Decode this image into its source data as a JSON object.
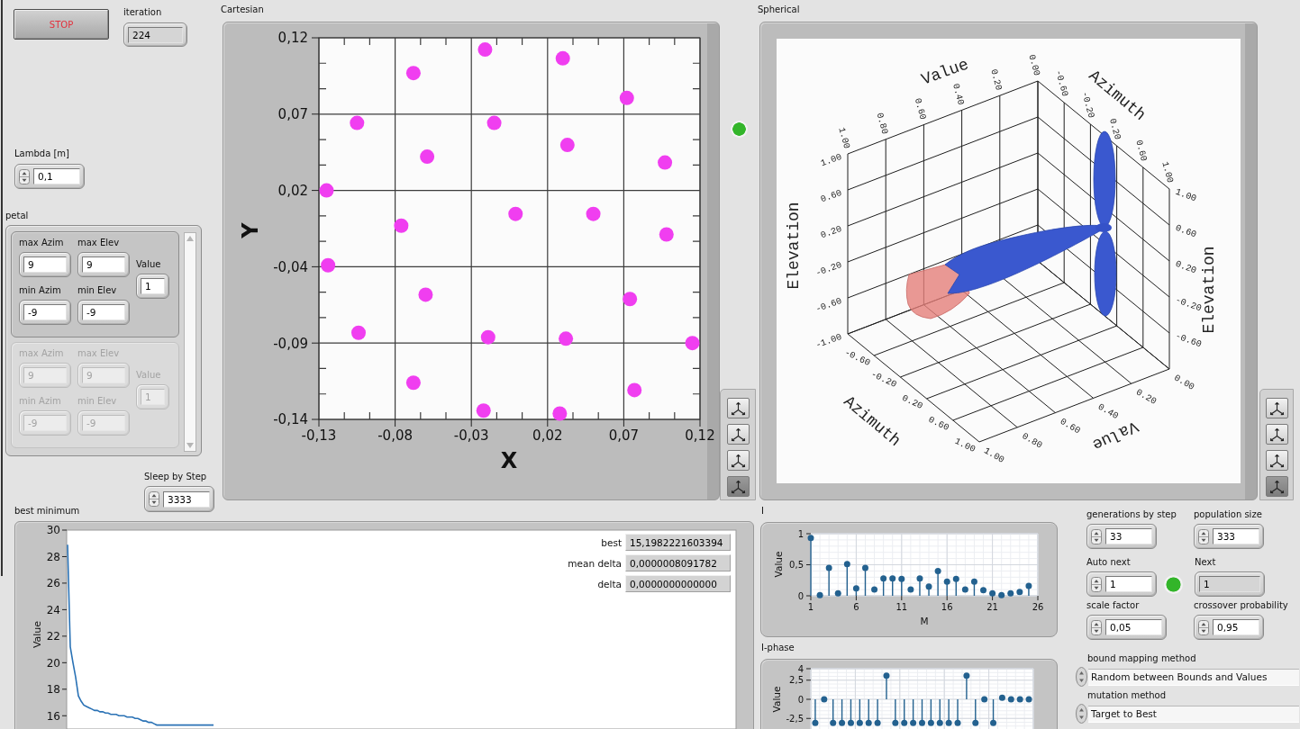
{
  "stop_button": {
    "label": "STOP"
  },
  "iteration": {
    "label": "iteration",
    "kind": "indicator",
    "value": "224"
  },
  "lambda": {
    "label": "Lambda [m]",
    "kind": "spin",
    "value": "0,1"
  },
  "petal": {
    "label": "petal",
    "elements": [
      {
        "disabled": false,
        "fields": [
          {
            "label": "max Azim",
            "value": "9"
          },
          {
            "label": "max Elev",
            "value": "9"
          },
          {
            "label": "Value",
            "value": "1"
          },
          {
            "label": "min Azim",
            "value": "-9"
          },
          {
            "label": "min Elev",
            "value": "-9"
          }
        ]
      },
      {
        "disabled": true,
        "fields": [
          {
            "label": "max Azim",
            "value": "9"
          },
          {
            "label": "max Elev",
            "value": "9"
          },
          {
            "label": "Value",
            "value": "1"
          },
          {
            "label": "min Azim",
            "value": "-9"
          },
          {
            "label": "min Elev",
            "value": "-9"
          }
        ]
      }
    ]
  },
  "sleep_by_step": {
    "label": "Sleep by Step",
    "kind": "spin",
    "value": "3333"
  },
  "cartesian": {
    "label": "Cartesian",
    "chart_data": [
      {
        "type": "scatter",
        "xlabel": "X",
        "ylabel": "Y",
        "xlim": [
          -0.13,
          0.12
        ],
        "ylim": [
          -0.14,
          0.12
        ],
        "xticks": [
          {
            "value": -0.13,
            "label": "-0,13"
          },
          {
            "value": -0.08,
            "label": "-0,08"
          },
          {
            "value": -0.03,
            "label": "-0,03"
          },
          {
            "value": 0.02,
            "label": "0,02"
          },
          {
            "value": 0.07,
            "label": "0,07"
          },
          {
            "value": 0.12,
            "label": "0,12"
          }
        ],
        "yticks": [
          {
            "value": 0.12,
            "label": "0,12"
          },
          {
            "value": 0.068,
            "label": "0,07"
          },
          {
            "value": 0.016,
            "label": "0,02"
          },
          {
            "value": -0.036,
            "label": "-0,04"
          },
          {
            "value": -0.088,
            "label": "-0,09"
          },
          {
            "value": -0.14,
            "label": "-0,14"
          }
        ],
        "grid": true,
        "color": "#f03ef0",
        "x": [
          -0.021,
          0.03,
          -0.068,
          0.072,
          -0.105,
          -0.015,
          0.033,
          -0.059,
          0.097,
          -0.125,
          -0.001,
          0.05,
          -0.076,
          0.098,
          -0.124,
          -0.06,
          0.074,
          -0.104,
          -0.019,
          0.032,
          0.115,
          -0.068,
          0.077,
          -0.022,
          0.028
        ],
        "values": [
          0.112,
          0.106,
          0.096,
          0.079,
          0.062,
          0.062,
          0.047,
          0.039,
          0.035,
          0.016,
          0,
          0,
          -0.008,
          -0.014,
          -0.035,
          -0.055,
          -0.058,
          -0.081,
          -0.084,
          -0.085,
          -0.088,
          -0.115,
          -0.12,
          -0.134,
          -0.136
        ]
      }
    ],
    "palette": [
      {
        "selected": false
      },
      {
        "selected": false
      },
      {
        "selected": false
      },
      {
        "selected": true
      }
    ]
  },
  "status_led": {
    "on": true
  },
  "spherical": {
    "label": "Spherical",
    "axes": [
      {
        "kind": "topleft",
        "title": "Value",
        "ticks": [
          "1.00",
          "0.80",
          "0.60",
          "0.40",
          "0.20",
          "0.00"
        ]
      },
      {
        "kind": "topright",
        "title": "Azimuth",
        "ticks": [
          "-0.60",
          "-0.20",
          "0.20",
          "0.60",
          "1.00"
        ]
      },
      {
        "kind": "left",
        "title": "Elevation",
        "ticks": [
          "1.00",
          "0.60",
          "0.20",
          "-0.20",
          "-0.60",
          "-1.00"
        ]
      },
      {
        "kind": "right",
        "title": "Elevation",
        "ticks": [
          "1.00",
          "0.60",
          "0.20",
          "-0.20",
          "-0.60"
        ]
      },
      {
        "kind": "bottomleft",
        "title": "Azimuth",
        "ticks": [
          "-0.60",
          "-0.20",
          "0.20",
          "0.60",
          "1.00"
        ]
      },
      {
        "kind": "bottomright",
        "title": "Value",
        "ticks": [
          "0.00",
          "0.20",
          "0.40",
          "0.60",
          "0.80",
          "1.00"
        ]
      }
    ],
    "palette": [
      {
        "selected": false
      },
      {
        "selected": false
      },
      {
        "selected": false
      },
      {
        "selected": true
      }
    ]
  },
  "best_minimum": {
    "label": "best minimum",
    "readouts": [
      {
        "label": "best",
        "value": "15,1982221603394"
      },
      {
        "label": "mean delta",
        "value": "0,0000008091782"
      },
      {
        "label": "delta",
        "value": "0,0000000000000"
      }
    ],
    "chart_data": [
      {
        "type": "line",
        "ylabel": "Value",
        "ylim": [
          15,
          30
        ],
        "yticks": [
          {
            "value": 16,
            "label": "16"
          },
          {
            "value": 18,
            "label": "18"
          },
          {
            "value": 20,
            "label": "20"
          },
          {
            "value": 22,
            "label": "22"
          },
          {
            "value": 24,
            "label": "24"
          },
          {
            "value": 26,
            "label": "26"
          },
          {
            "value": 28,
            "label": "28"
          },
          {
            "value": 30,
            "label": "30"
          }
        ],
        "tick_labels": "y",
        "color": "#2a72b5",
        "values": [
          28.9,
          21.2,
          20.0,
          18.9,
          17.5,
          17.1,
          16.8,
          16.7,
          16.6,
          16.5,
          16.4,
          16.4,
          16.3,
          16.3,
          16.2,
          16.2,
          16.1,
          16.1,
          16.1,
          16.0,
          16.0,
          16.0,
          15.9,
          15.9,
          15.9,
          15.8,
          15.8,
          15.7,
          15.6,
          15.6,
          15.5,
          15.5,
          15.4,
          15.3,
          15.3,
          15.3,
          15.3,
          15.3,
          15.3,
          15.3,
          15.3,
          15.3,
          15.3,
          15.3,
          15.3,
          15.3,
          15.3,
          15.3,
          15.3,
          15.3,
          15.3,
          15.3,
          15.3,
          15.3,
          15.3
        ]
      }
    ]
  },
  "i_chart": {
    "label": "I",
    "chart_data": [
      {
        "type": "lollipop",
        "xlabel": "M",
        "ylabel": "Value",
        "x": [
          1,
          2,
          3,
          4,
          5,
          6,
          7,
          8,
          9,
          10,
          11,
          12,
          13,
          14,
          15,
          16,
          17,
          18,
          19,
          20,
          21,
          22,
          23,
          24,
          25
        ],
        "xlim": [
          1,
          26
        ],
        "ylim": [
          0,
          1
        ],
        "xticks": [
          {
            "value": 1,
            "label": "1"
          },
          {
            "value": 6,
            "label": "6"
          },
          {
            "value": 11,
            "label": "11"
          },
          {
            "value": 16,
            "label": "16"
          },
          {
            "value": 21,
            "label": "21"
          },
          {
            "value": 26,
            "label": "26"
          }
        ],
        "yticks": [
          {
            "value": 1,
            "label": "1"
          },
          {
            "value": 0.5,
            "label": "0,5"
          },
          {
            "value": 0,
            "label": "0"
          }
        ],
        "grid": true,
        "color": "#23618f",
        "values": [
          0.93,
          0.01,
          0.45,
          0.04,
          0.51,
          0.12,
          0.45,
          0.1,
          0.28,
          0.28,
          0.27,
          0.1,
          0.28,
          0.15,
          0.4,
          0.23,
          0.27,
          0.1,
          0.23,
          0.09,
          0.04,
          0.01,
          0.04,
          0.06,
          0.16
        ]
      }
    ]
  },
  "i_phase_chart": {
    "label": "I-phase",
    "chart_data": [
      {
        "type": "lollipop",
        "ylabel": "Value",
        "ylim": [
          -4,
          4
        ],
        "yticks": [
          {
            "value": 4,
            "label": "4"
          },
          {
            "value": 2.5,
            "label": "2,5"
          },
          {
            "value": 0,
            "label": "0"
          },
          {
            "value": -2.5,
            "label": "-2,5"
          }
        ],
        "tick_labels": "y",
        "grid": true,
        "color": "#23618f",
        "values": [
          -3.1,
          0,
          -3.1,
          -3.1,
          -3.1,
          -3.1,
          -3.1,
          -3.1,
          3.1,
          -3.1,
          -3.1,
          -3.1,
          -3.1,
          -3.1,
          -3.1,
          -3.1,
          -3.1,
          3.1,
          -3.1,
          0,
          -3.1,
          0.2,
          0,
          0,
          0
        ]
      }
    ]
  },
  "generations_by_step": {
    "label": "generations by step",
    "kind": "spin",
    "value": "33"
  },
  "population_size": {
    "label": "population size",
    "kind": "spin",
    "value": "333"
  },
  "auto_next": {
    "label": "Auto next",
    "kind": "spin",
    "value": "1"
  },
  "auto_next_led": {
    "on": true
  },
  "next": {
    "label": "Next",
    "kind": "indicator",
    "value": "1"
  },
  "scale_factor": {
    "label": "scale factor",
    "kind": "spin",
    "value": "0,05"
  },
  "crossover_probability": {
    "label": "crossover probability",
    "kind": "spin",
    "value": "0,95"
  },
  "bound_mapping_method": {
    "label": "bound mapping method",
    "value": "Random between Bounds and Values"
  },
  "mutation_method": {
    "label": "mutation method",
    "value": "Target to Best"
  }
}
